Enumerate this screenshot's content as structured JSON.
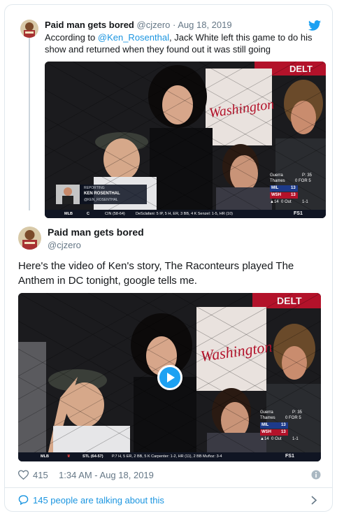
{
  "parent_tweet": {
    "name": "Paid man gets bored",
    "handle": "@cjzero",
    "date": "Aug 18, 2019",
    "text_pre": "According to ",
    "mention": "@Ken_Rosenthal",
    "text_post": ", Jack White left this game to do his show and returned when they found out it was still going",
    "video": {
      "reporter_label": "REPORTING",
      "reporter_name": "KEN ROSENTHAL",
      "reporter_handle": "@KEN_ROSENTHAL",
      "ticker_league": "MLB",
      "ticker_team": "CIN (58-64)",
      "ticker_stats": "DeSclafani: 5 IP, 5 H, ER, 3 BB, 4 K  Senzel: 1-5, HR (10)",
      "network": "FS1",
      "pitcher": "Guerra",
      "pitch_count": "P: 35",
      "batter": "Thames",
      "batter_line": "0 FOR 5",
      "team1": "MIL",
      "score1": "13",
      "team2": "WSH",
      "score2": "13",
      "inning": "▲14",
      "outs": "0 Out",
      "count": "1-1",
      "sign": "Washington"
    }
  },
  "main_tweet": {
    "name": "Paid man gets bored",
    "handle": "@cjzero",
    "text": "Here's the video of Ken's story, The Raconteurs played The Anthem in DC tonight, google tells me.",
    "video": {
      "ticker_league": "MLB",
      "ticker_team": "STL (64-57)",
      "ticker_stats": "P.7 H, 5 ER, 2 BB, 5 K  Carpenter: 1-2, HR (11), 2 BB  Muñoz: 3-4",
      "network": "FS1",
      "pitcher": "Guerra",
      "pitch_count": "P: 35",
      "batter": "Thames",
      "batter_line": "0 FOR 5",
      "team1": "MIL",
      "score1": "13",
      "team2": "WSH",
      "score2": "13",
      "inning": "▲14",
      "outs": "0 Out",
      "count": "1-1",
      "sign": "Washington"
    },
    "like_count": "415",
    "timestamp": "1:34 AM - Aug 18, 2019"
  },
  "talking": "145 people are talking about this",
  "colors": {
    "link": "#1b95e0",
    "muted": "#657786",
    "border": "#e1e8ed",
    "play": "#1da1f2"
  },
  "icons": [
    "twitter-bird-icon",
    "heart-icon",
    "info-icon",
    "speech-bubble-icon",
    "chevron-right-icon",
    "play-icon"
  ]
}
